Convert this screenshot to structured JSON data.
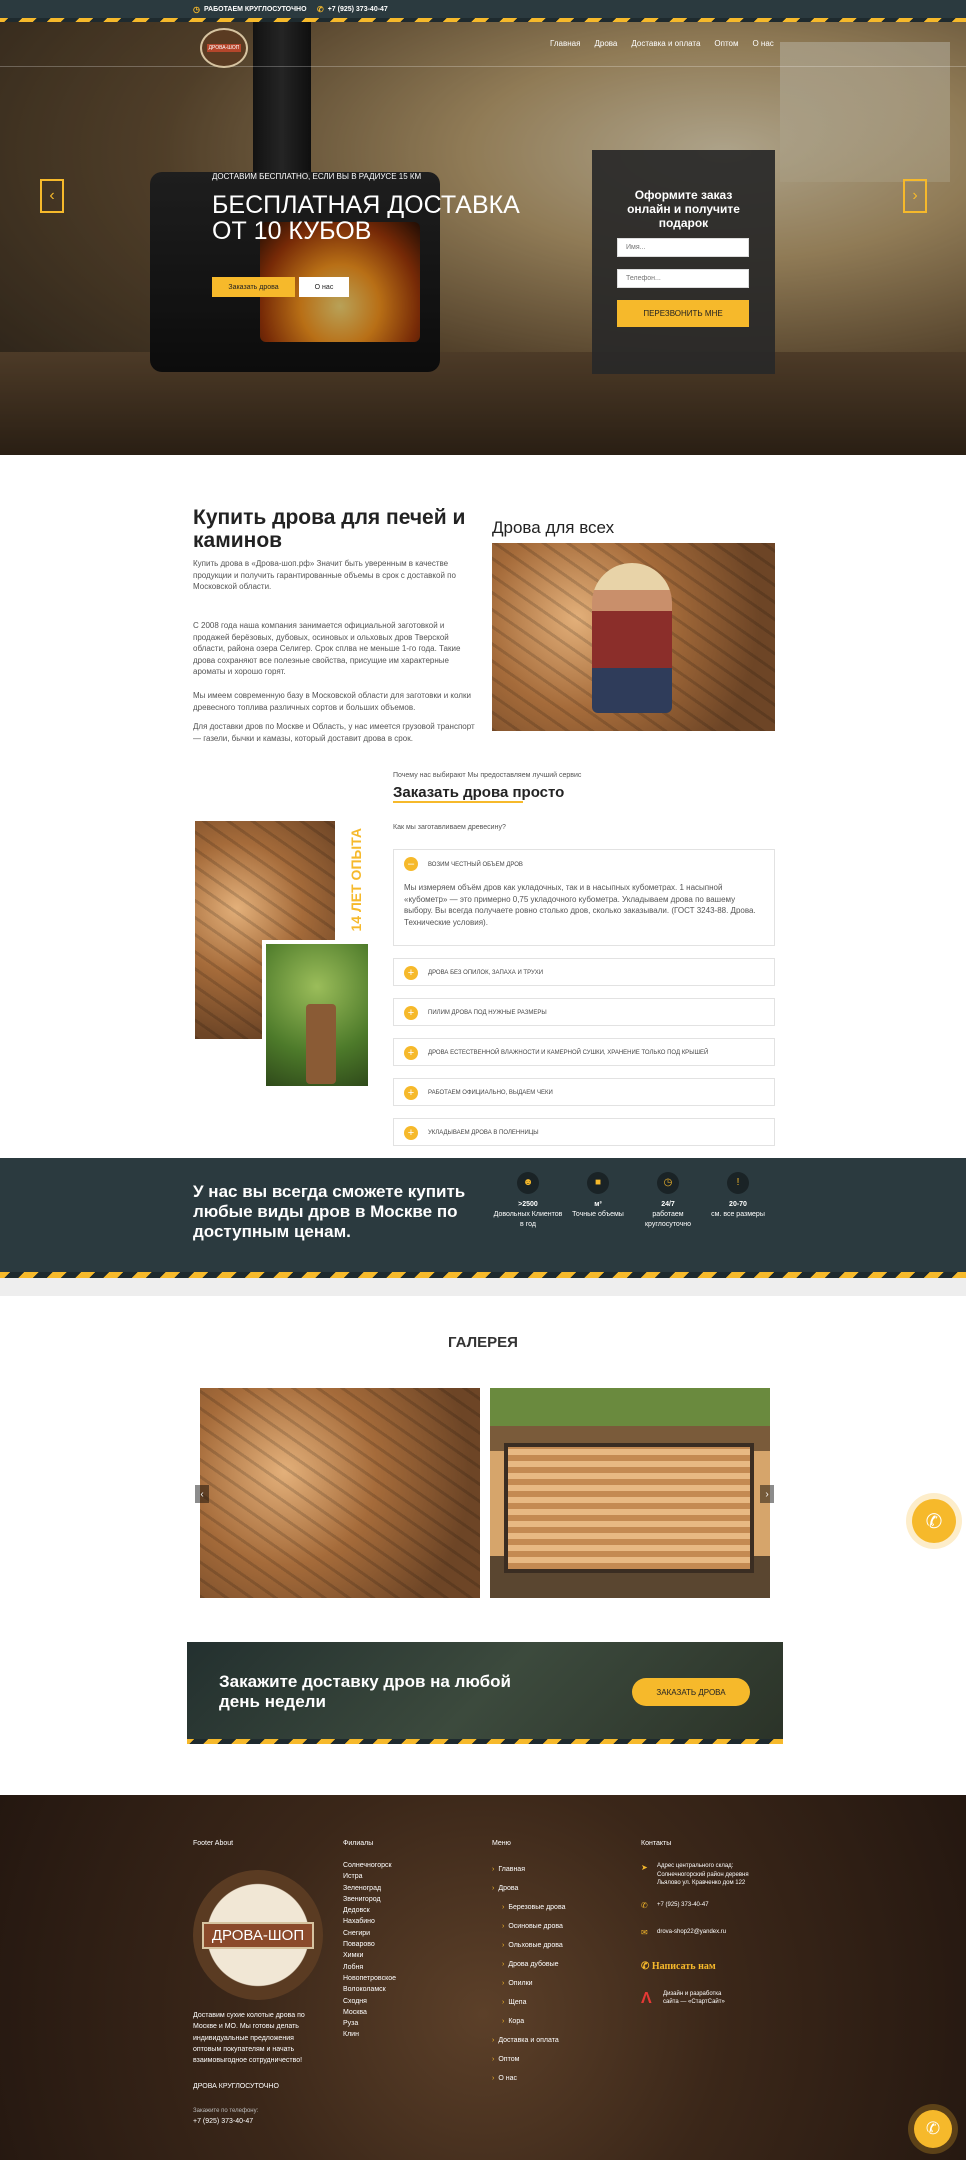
{
  "topbar": {
    "hours": "РАБОТАЕМ КРУГЛОСУТОЧНО",
    "phone": "+7 (925) 373-40-47"
  },
  "logo": {
    "text": "ДРОВА-ШОП"
  },
  "nav": [
    "Главная",
    "Дрова",
    "Доставка и оплата",
    "Оптом",
    "О нас"
  ],
  "hero": {
    "subtitle": "ДОСТАВИМ БЕСПЛАТНО, ЕСЛИ ВЫ В РАДИУСЕ 15 КМ",
    "title": "БЕСПЛАТНАЯ ДОСТАВКА ОТ 10 КУБОВ",
    "order_button": "Заказать дрова",
    "about_button": "О нас",
    "prev": "‹",
    "next": "›"
  },
  "form": {
    "title": "Оформите заказ онлайн и получите подарок",
    "name_placeholder": "Имя...",
    "phone_placeholder": "Телефон...",
    "submit": "ПЕРЕЗВОНИТЬ МНЕ"
  },
  "about": {
    "title": "Купить дрова для печей и каминов",
    "p1": "Купить дрова в «Дрова-шоп.рф» Значит быть уверенным в качестве продукции и получить гарантированные объемы в срок с доставкой по Московской области.",
    "p2": "С 2008 года наша компания занимается официальной заготовкой и продажей берёзовых, дубовых, осиновых и ольховых дров Тверской области, района озера Селигер. Срок сплва не меньше 1-го года. Такие дрова сохраняют все полезные свойства, присущие им характерные ароматы и хорошо горят.",
    "p3": "Мы имеем современную базу в Московской области для заготовки и колки древесного топлива различных сортов и больших объемов.",
    "p4": "Для доставки дров по Москве и Область, у нас имеется грузовой транспорт — газели, бычки и камазы, который доставит дрова в срок.",
    "side_title": "Дрова для всех"
  },
  "why": {
    "kicker": "Почему нас выбирают Мы предоставляем лучший сервис",
    "title": "Заказать дрова просто",
    "question": "Как мы заготавливаем древесину?",
    "experience": "14 ЛЕТ ОПЫТА",
    "open_item": {
      "title": "Возим честный объем дров",
      "text": "Мы измеряем объём дров как укладочных, так и в насыпных кубометрах. 1 насыпной «кубометр» — это примерно 0,75 укладочного кубометра. Укладываем дрова по вашему выбору. Вы всегда получаете ровно столько дров, сколько заказывали. (ГОСТ 3243-88. Дрова. Технические условия)."
    },
    "items": [
      "Дрова без опилок, запаха и трухи",
      "Пилим дрова под нужные размеры",
      "Дрова естественной влажности и камерной сушки, хранение только под крышей",
      "Работаем официально, выдаем чеки",
      "Укладываем дрова в поленницы"
    ]
  },
  "band": {
    "title": "У нас вы всегда сможете купить любые виды дров в Москве по доступным ценам.",
    "stats": [
      {
        "value": ">2500",
        "label": "Довольных Клиентов в год"
      },
      {
        "value": "м³",
        "label": "Точные объемы"
      },
      {
        "value": "24/7",
        "label": "работаем круглосуточно"
      },
      {
        "value": "20-70",
        "label": "см. все размеры"
      }
    ]
  },
  "gallery": {
    "title": "ГАЛЕРЕЯ",
    "prev": "‹",
    "next": "›"
  },
  "cta": {
    "title": "Закажите доставку дров на любой день недели",
    "button": "ЗАКАЗАТЬ ДРОВА"
  },
  "footer": {
    "about_head": "Footer About",
    "about_text": "Доставим сухие колотые дрова по Москве и МО. Мы готовы делать индивидуальные предложения оптовым покупателям и начать взаимовыгодное сотрудничество!",
    "hours": "ДРОВА КРУГЛОСУТОЧНО",
    "call_label": "Закажите по телефону:",
    "phone": "+7 (925) 373-40-47",
    "branches_head": "Филиалы",
    "branches": [
      "Солнечногорск",
      "Истра",
      "Зеленоград",
      "Звенигород",
      "Дедовск",
      "Нахабино",
      "Снегири",
      "Поварово",
      "Химки",
      "Лобня",
      "Новопетровское",
      "Волоколамск",
      "Сходня",
      "Москва",
      "Руза",
      "Клин"
    ],
    "menu_head": "Меню",
    "menu": [
      {
        "label": "Главная",
        "sub": false
      },
      {
        "label": "Дрова",
        "sub": false
      },
      {
        "label": "Березовые дрова",
        "sub": true
      },
      {
        "label": "Осиновые дрова",
        "sub": true
      },
      {
        "label": "Ольховые дрова",
        "sub": true
      },
      {
        "label": "Дрова дубовые",
        "sub": true
      },
      {
        "label": "Опилки",
        "sub": true
      },
      {
        "label": "Щепа",
        "sub": true
      },
      {
        "label": "Кора",
        "sub": true
      },
      {
        "label": "Доставка и оплата",
        "sub": false
      },
      {
        "label": "Оптом",
        "sub": false
      },
      {
        "label": "О нас",
        "sub": false
      }
    ],
    "contacts_head": "Контакты",
    "address": "Адрес центрального склад: Солнечногорский район деревня Льялово ул. Кравченко дом 122",
    "contact_phone": "+7 (925) 373-40-47",
    "email": "drova-shop22@yandex.ru",
    "whatsapp": "Написать нам",
    "dev": "Дизайн и разработка сайта — «СтартСайт»"
  },
  "colors": {
    "accent": "#f6b92b",
    "dark": "#2b3a3f"
  }
}
